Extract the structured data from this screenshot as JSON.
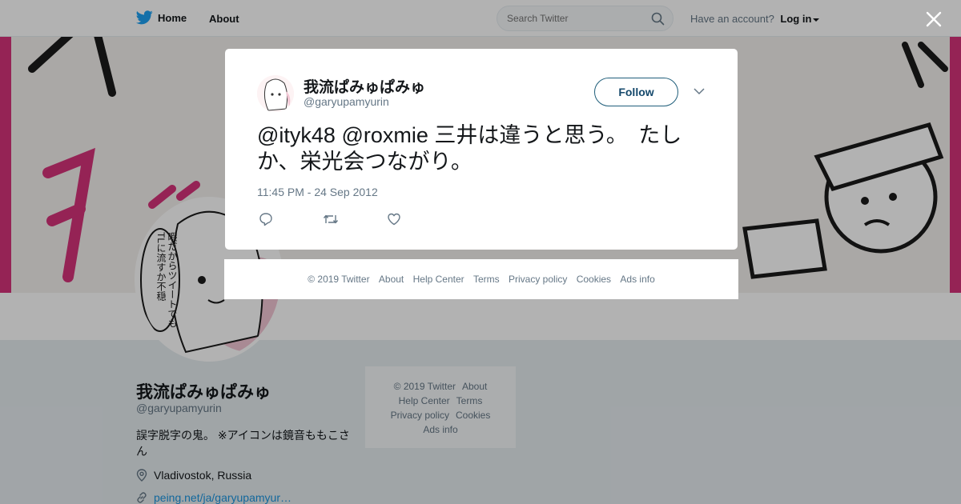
{
  "topbar": {
    "home_label": "Home",
    "about_label": "About",
    "search_placeholder": "Search Twitter",
    "account_prompt": "Have an account?",
    "login_label": "Log in"
  },
  "profile": {
    "name": "我流ぱみゅぱみゅ",
    "handle": "@garyupamyurin",
    "bio": "誤字脱字の鬼。 ※アイコンは鏡音ももこさん",
    "location": "Vladivostok, Russia",
    "link": "peing.net/ja/garyupamyur…",
    "avatar_speech": "暇だからツイートでもTLに流すか不穏"
  },
  "side_footer": {
    "copyright": "© 2019 Twitter",
    "about": "About",
    "help_center": "Help Center",
    "terms": "Terms",
    "privacy": "Privacy policy",
    "cookies": "Cookies",
    "ads_info": "Ads info"
  },
  "tweet": {
    "author_name": "我流ぱみゅぱみゅ",
    "author_handle": "@garyupamyurin",
    "follow_label": "Follow",
    "text": "@ityk48 @roxmie 三井は違うと思う。　たしか、栄光会つながり。",
    "timestamp": "11:45 PM - 24 Sep 2012"
  },
  "modal_footer": {
    "copyright": "© 2019 Twitter",
    "about": "About",
    "help_center": "Help Center",
    "terms": "Terms",
    "privacy": "Privacy policy",
    "cookies": "Cookies",
    "ads_info": "Ads info"
  },
  "icons": {
    "logo": "twitter-bird-icon",
    "search": "search-icon",
    "close": "close-icon",
    "more": "chevron-down-icon",
    "reply": "reply-icon",
    "retweet": "retweet-icon",
    "like": "heart-icon",
    "location": "location-pin-icon",
    "link": "link-icon"
  },
  "colors": {
    "brand": "#1da1f2",
    "banner_accent": "#d6337a"
  }
}
